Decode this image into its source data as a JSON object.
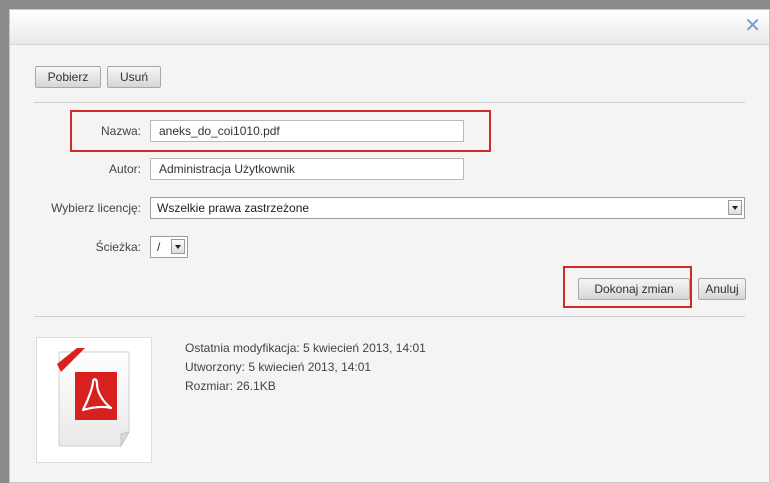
{
  "dialog": {
    "close_glyph": "✕"
  },
  "toolbar": {
    "download_label": "Pobierz",
    "delete_label": "Usuń"
  },
  "form": {
    "name_label": "Nazwa:",
    "name_value": "aneks_do_coi1010.pdf",
    "author_label": "Autor:",
    "author_value": "Administracja Użytkownik",
    "license_label": "Wybierz licencję:",
    "license_value": "Wszelkie prawa zastrzeżone",
    "path_label": "Ścieżka:",
    "path_value": "/"
  },
  "actions": {
    "apply_label": "Dokonaj zmian",
    "cancel_label": "Anuluj"
  },
  "file_info": {
    "modified": "Ostatnia modyfikacja: 5 kwiecień 2013, 14:01",
    "created": "Utworzony: 5 kwiecień 2013, 14:01",
    "size": "Rozmiar: 26.1KB"
  },
  "icons": {
    "file_icon": "pdf-file-icon",
    "close_icon": "close-icon"
  },
  "colors": {
    "highlight_red": "#d12a2a",
    "pdf_red": "#d8201f",
    "close_blue": "#6f9fd6"
  }
}
